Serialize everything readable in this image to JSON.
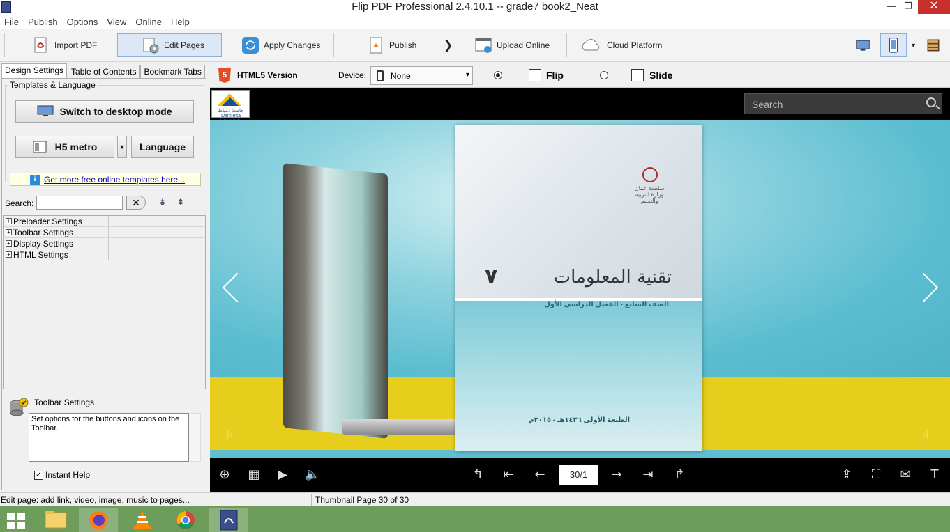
{
  "window": {
    "title": "Flip PDF Professional 2.4.10.1 -- grade7 book2_Neat",
    "minimize": "—",
    "restore": "❐",
    "close": "✕"
  },
  "menu": [
    "File",
    "Publish",
    "Options",
    "View",
    "Online",
    "Help"
  ],
  "toolbar": {
    "import_pdf": "Import PDF",
    "edit_pages": "Edit Pages",
    "apply_changes": "Apply Changes",
    "publish": "Publish",
    "upload_online": "Upload Online",
    "cloud_platform": "Cloud Platform",
    "arrow": "❯",
    "dropdown": "▼"
  },
  "left": {
    "tabs": [
      "Design Settings",
      "Table of Contents",
      "Bookmark Tabs"
    ],
    "group_label": "Templates & Language",
    "switch_desktop": "Switch to desktop mode",
    "template": "H5 metro",
    "template_dropdown": "▼",
    "language": "Language",
    "info_link": "Get more free online templates here...",
    "info_icon": "i",
    "search_label": "Search:",
    "search_value": "",
    "clear": "✕",
    "tree": [
      {
        "label": "Preloader Settings",
        "value": ""
      },
      {
        "label": "Toolbar Settings",
        "value": ""
      },
      {
        "label": "Display Settings",
        "value": ""
      },
      {
        "label": "HTML Settings",
        "value": ""
      }
    ],
    "expander": "+",
    "help_title": "Toolbar Settings",
    "help_text": "Set options for the buttons and icons on the Toolbar.",
    "instant_help": "Instant Help",
    "instant_checked": "✓"
  },
  "right": {
    "html5_badge": "5",
    "html5_version": "HTML5 Version",
    "device_label": "Device:",
    "device_value": "None",
    "device_dropdown": "▾",
    "mode_flip": "Flip",
    "mode_slide": "Slide",
    "mode_selected": "flip"
  },
  "viewer": {
    "logo_text": "جامعة دمياط Damietta University",
    "search_placeholder": "Search",
    "book": {
      "emblem_text": "سلطنة عمان وزارة التربية والتعليم",
      "title": "تقنية المعلومات",
      "number": "٧",
      "subtitle": "الصف السابع - الفصل الدراسي الأول",
      "edition": "الطبعة الأولى ١٤٣٦هـ - ٢٠١٥م"
    },
    "faint_left": "|‹",
    "faint_right": "›|",
    "page_indicator": "30/1",
    "icons": {
      "zoom": "⊕",
      "thumbnails": "▦",
      "autoplay": "▶",
      "sound": "🔈",
      "first_turn": "↰",
      "first": "⇤",
      "prev": "←",
      "next": "→",
      "last": "⇥",
      "last_turn": "↱",
      "share": "⇪",
      "fullscreen": "⛶",
      "email": "✉",
      "text": "T"
    }
  },
  "status": {
    "left": "Edit page: add link, video, image, music to pages...",
    "right": "Thumbnail Page 30 of 30"
  },
  "colors": {
    "accent": "#dce8f5",
    "taskbar": "#6e9c5a",
    "close_button": "#c7302b",
    "book_title": "#333333"
  }
}
